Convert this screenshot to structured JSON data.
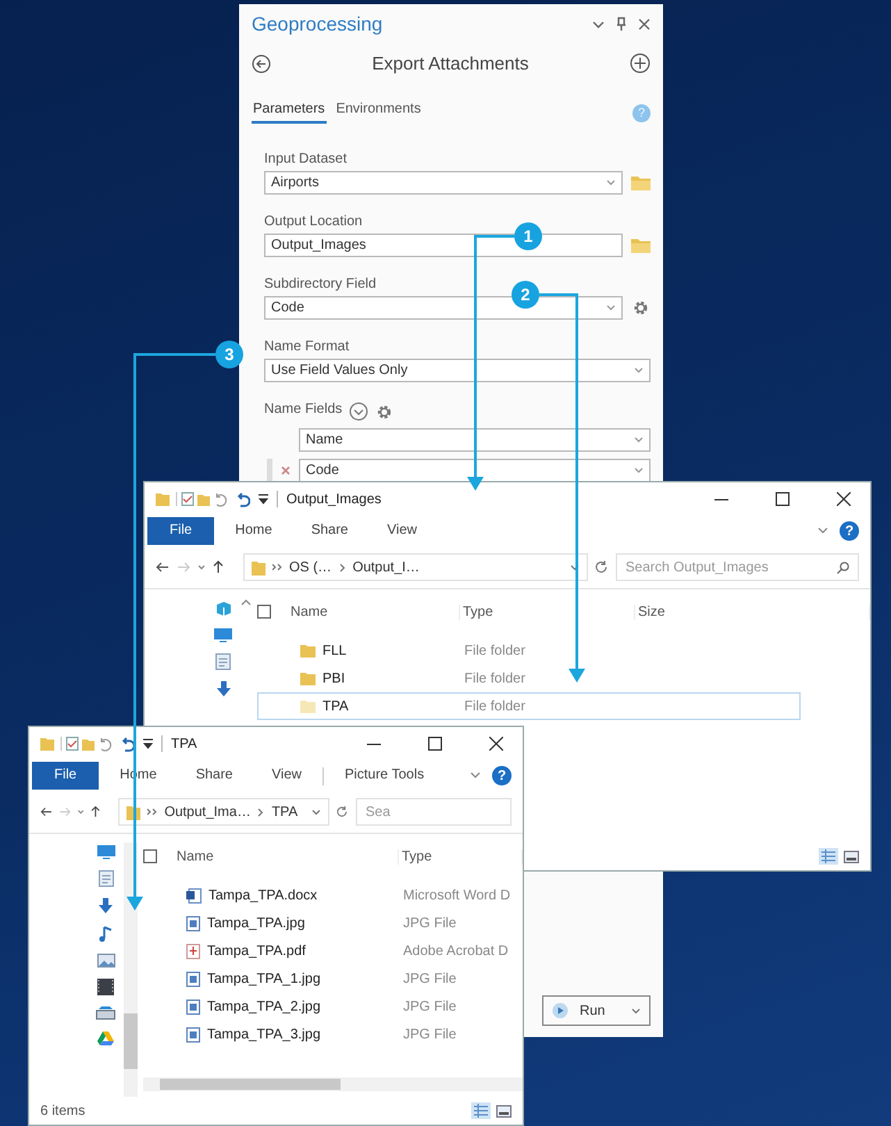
{
  "geoprocessing": {
    "title": "Geoprocessing",
    "tool": "Export Attachments",
    "help": "?",
    "tabs": [
      {
        "label": "Parameters",
        "selected": true
      },
      {
        "label": "Environments",
        "selected": false
      }
    ],
    "parameters": [
      {
        "label": "Input Dataset",
        "dropdown": true,
        "value": "Airports",
        "kind": "folder"
      },
      {
        "label": "Output Location",
        "dropdown": false,
        "value": "Output_Images",
        "kind": "folder"
      },
      {
        "label": "Subdirectory Field",
        "dropdown": true,
        "value": "Code",
        "kind": "gear"
      },
      {
        "label": "Name Format",
        "dropdown": true,
        "value": "Use Field Values Only",
        "kind": "plain"
      }
    ],
    "name_fields": {
      "label": "Name Fields",
      "rows": [
        {
          "value": "Name",
          "removable": false
        },
        {
          "value": "Code",
          "removable": true
        }
      ]
    },
    "run_button": "Run"
  },
  "explorers": [
    {
      "title": "Output_Images",
      "help": "?",
      "select_all_checked": false,
      "ribbon": [
        {
          "label": "File",
          "kind": "tab",
          "selected": true
        },
        {
          "label": "Home",
          "kind": "tab",
          "selected": false
        },
        {
          "label": "Share",
          "kind": "tab",
          "selected": false
        },
        {
          "label": "View",
          "kind": "tab",
          "selected": false
        }
      ],
      "path": [
        "OS (…",
        "Output_I…"
      ],
      "search_placeholder": "Search Output_Images",
      "columns": [
        "Name",
        "Type",
        "Size"
      ],
      "rows": [
        {
          "name": "FLL",
          "type": "File folder",
          "kind": "folder",
          "selected": false
        },
        {
          "name": "PBI",
          "type": "File folder",
          "kind": "folder",
          "selected": false
        },
        {
          "name": "TPA",
          "type": "File folder",
          "kind": "folder",
          "selected": true
        }
      ]
    },
    {
      "title": "TPA",
      "help": "?",
      "select_all_checked": false,
      "ribbon": [
        {
          "label": "File",
          "kind": "tab",
          "selected": true
        },
        {
          "label": "Home",
          "kind": "tab",
          "selected": false
        },
        {
          "label": "Share",
          "kind": "tab",
          "selected": false
        },
        {
          "label": "View",
          "kind": "tab",
          "selected": false
        },
        {
          "label": "Picture Tools",
          "kind": "context",
          "selected": false
        }
      ],
      "path": [
        "Output_Ima…",
        "TPA"
      ],
      "search_placeholder": "Sea",
      "columns": [
        "Name",
        "Type"
      ],
      "rows": [
        {
          "name": "Tampa_TPA.docx",
          "type": "Microsoft Word D",
          "kind": "word",
          "selected": false
        },
        {
          "name": "Tampa_TPA.jpg",
          "type": "JPG File",
          "kind": "image",
          "selected": false
        },
        {
          "name": "Tampa_TPA.pdf",
          "type": "Adobe Acrobat D",
          "kind": "pdf",
          "selected": false
        },
        {
          "name": "Tampa_TPA_1.jpg",
          "type": "JPG File",
          "kind": "image",
          "selected": false
        },
        {
          "name": "Tampa_TPA_2.jpg",
          "type": "JPG File",
          "kind": "image",
          "selected": false
        },
        {
          "name": "Tampa_TPA_3.jpg",
          "type": "JPG File",
          "kind": "image",
          "selected": false
        }
      ],
      "status": "6 items"
    }
  ],
  "callouts": [
    {
      "number": "1"
    },
    {
      "number": "2"
    },
    {
      "number": "3"
    }
  ]
}
